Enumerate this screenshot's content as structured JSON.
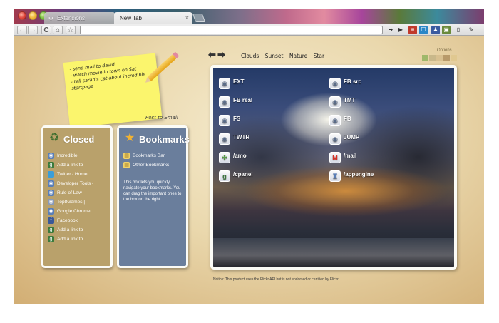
{
  "tabs": [
    {
      "label": "Extensions",
      "icon": "puzzle-icon"
    },
    {
      "label": "New Tab",
      "icon": "close-icon"
    }
  ],
  "toolbar": {
    "back": "←",
    "forward": "→",
    "reload": "C",
    "home": "⌂",
    "star": "☆",
    "omnibox_value": ""
  },
  "note": {
    "lines": [
      "- send mail to david",
      "- watch movie in town on Sat",
      "- tell sarah's cat about incredible",
      "startpage"
    ],
    "post_label": "Post to Email"
  },
  "closed": {
    "title": "Closed",
    "items": [
      {
        "label": "Incredible",
        "icon": "page-icon",
        "color": "#5a7fb8"
      },
      {
        "label": "Add a link to",
        "icon": "google-icon",
        "color": "#3b7a3b"
      },
      {
        "label": "Twitter / Home",
        "icon": "twitter-icon",
        "color": "#3a9ed8"
      },
      {
        "label": "Developer Tools -",
        "icon": "page-icon",
        "color": "#5a7fb8"
      },
      {
        "label": "Rule of Law -",
        "icon": "page-icon",
        "color": "#5a7fb8"
      },
      {
        "label": "Top8Games |",
        "icon": "page-icon",
        "color": "#8a9ab8"
      },
      {
        "label": "Google Chrome",
        "icon": "page-icon",
        "color": "#5a7fb8"
      },
      {
        "label": "Facebook",
        "icon": "facebook-icon",
        "color": "#3b5998"
      },
      {
        "label": "Add a link to",
        "icon": "google-icon",
        "color": "#3b7a3b"
      },
      {
        "label": "Add a link to",
        "icon": "google-icon",
        "color": "#3b7a3b"
      }
    ]
  },
  "bookmarks": {
    "title": "Bookmarks",
    "items": [
      {
        "label": "Bookmarks Bar",
        "icon": "folder-icon"
      },
      {
        "label": "Other Bookmarks",
        "icon": "folder-icon"
      }
    ],
    "description": "This box lets you quickly navigate your bookmarks. You can drag the important ones to the box on the right"
  },
  "photo": {
    "tabs": [
      "Clouds",
      "Sunset",
      "Nature",
      "Star"
    ],
    "options_label": "Options",
    "swatches": [
      "#9fb86a",
      "#c9b88a",
      "#d8c090",
      "#b89a6a",
      "#e0c890"
    ]
  },
  "shortcuts": [
    {
      "label": "EXT",
      "icon": "page-icon",
      "col": 0,
      "row": 0
    },
    {
      "label": "FB src",
      "icon": "page-icon",
      "col": 1,
      "row": 0
    },
    {
      "label": "FB real",
      "icon": "page-icon",
      "col": 0,
      "row": 1
    },
    {
      "label": "TMT",
      "icon": "page-icon",
      "col": 1,
      "row": 1
    },
    {
      "label": "FS",
      "icon": "page-icon",
      "col": 0,
      "row": 2
    },
    {
      "label": "FB",
      "icon": "page-icon",
      "col": 1,
      "row": 2
    },
    {
      "label": "TWTR",
      "icon": "page-icon",
      "col": 0,
      "row": 3
    },
    {
      "label": "JUMP",
      "icon": "page-icon",
      "col": 1,
      "row": 3
    },
    {
      "label": "/amo",
      "icon": "puzzle-icon",
      "col": 0,
      "row": 4
    },
    {
      "label": "/mail",
      "icon": "gmail-icon",
      "col": 1,
      "row": 4
    },
    {
      "label": "/cpanel",
      "icon": "google-icon",
      "col": 0,
      "row": 5
    },
    {
      "label": "/appengine",
      "icon": "appengine-icon",
      "col": 1,
      "row": 5
    }
  ],
  "notice": "Notice: This product uses the Flickr API but is not endorsed or certified by Flickr."
}
